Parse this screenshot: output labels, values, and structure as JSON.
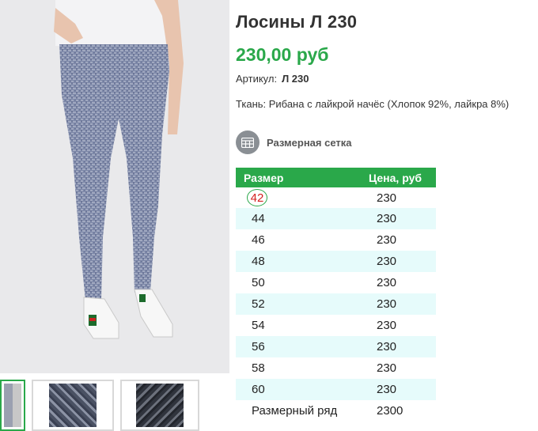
{
  "product": {
    "title": "Лосины Л 230",
    "price": "230,00 руб",
    "article_label": "Артикул:",
    "article_value": "Л 230",
    "fabric": "Ткань: Рибана с лайкрой начёс (Хлопок 92%, лайкра 8%)"
  },
  "size_chart_link": {
    "label": "Размерная сетка",
    "icon": "table-icon"
  },
  "table": {
    "headers": [
      "Размер",
      "Цена, руб"
    ],
    "rows": [
      {
        "size": "42",
        "price": "230"
      },
      {
        "size": "44",
        "price": "230"
      },
      {
        "size": "46",
        "price": "230"
      },
      {
        "size": "48",
        "price": "230"
      },
      {
        "size": "50",
        "price": "230"
      },
      {
        "size": "52",
        "price": "230"
      },
      {
        "size": "54",
        "price": "230"
      },
      {
        "size": "56",
        "price": "230"
      },
      {
        "size": "58",
        "price": "230"
      },
      {
        "size": "60",
        "price": "230"
      },
      {
        "size": "Размерный ряд",
        "price": "2300"
      }
    ]
  },
  "colors": {
    "accent": "#2aa84a",
    "highlight_ring": "#2aa84a",
    "highlight_text": "#d42020",
    "row_alt": "#e6fbfb"
  }
}
